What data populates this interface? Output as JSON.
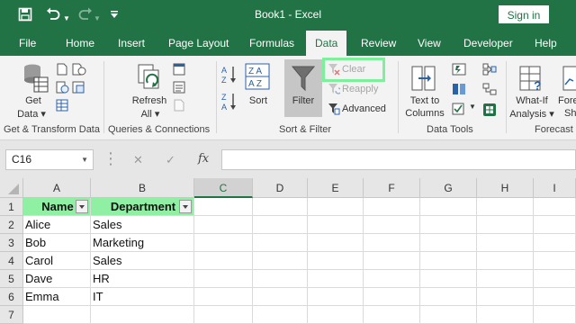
{
  "titlebar": {
    "title": "Book1  -  Excel",
    "sign_in": "Sign in",
    "save_icon": "save-icon",
    "undo_icon": "undo-icon",
    "redo_icon": "redo-icon",
    "customize_icon": "customize-qat-icon"
  },
  "tabs": [
    "File",
    "Home",
    "Insert",
    "Page Layout",
    "Formulas",
    "Data",
    "Review",
    "View",
    "Developer",
    "Help"
  ],
  "active_tab": "Data",
  "ribbon": {
    "get_data": {
      "line1": "Get",
      "line2": "Data"
    },
    "refresh_all": {
      "line1": "Refresh",
      "line2": "All"
    },
    "sort": "Sort",
    "filter": "Filter",
    "clear": "Clear",
    "reapply": "Reapply",
    "advanced": "Advanced",
    "text_to_columns": {
      "line1": "Text to",
      "line2": "Columns"
    },
    "what_if": {
      "line1": "What-If",
      "line2": "Analysis"
    },
    "forecast_sheet": {
      "line1": "Fore",
      "line2": "Sh"
    },
    "groups": {
      "get_transform": "Get & Transform Data",
      "queries": "Queries & Connections",
      "sort_filter": "Sort & Filter",
      "data_tools": "Data Tools",
      "forecast": "Forecast"
    }
  },
  "formula_bar": {
    "name_box": "C16",
    "fx": "fx",
    "cancel": "✕",
    "enter": "✓",
    "value": ""
  },
  "sheet": {
    "columns": [
      "A",
      "B",
      "C",
      "D",
      "E",
      "F",
      "G",
      "H",
      "I"
    ],
    "rows": [
      "1",
      "2",
      "3",
      "4",
      "5",
      "6",
      "7"
    ],
    "header": [
      "Name",
      "Department"
    ],
    "data": [
      [
        "Alice",
        "Sales"
      ],
      [
        "Bob",
        "Marketing"
      ],
      [
        "Carol",
        "Sales"
      ],
      [
        "Dave",
        "HR"
      ],
      [
        "Emma",
        "IT"
      ]
    ]
  },
  "colors": {
    "excel_green": "#217346",
    "header_fill": "#8ff0a4",
    "highlight": "#7cf09a"
  }
}
